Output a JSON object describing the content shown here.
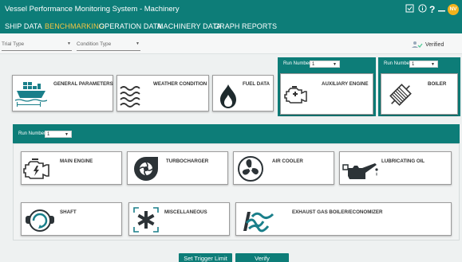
{
  "app": {
    "title": "Vessel Performance Monitoring System - Machinery",
    "avatar_initials": "NV"
  },
  "nav": {
    "items": [
      {
        "label": "SHIP DATA"
      },
      {
        "label": "BENCHMARKING"
      },
      {
        "label": "OPERATION DATA"
      },
      {
        "label": "MACHINERY DATA"
      },
      {
        "label": "GRAPH"
      },
      {
        "label": "REPORTS"
      }
    ],
    "active": "BENCHMARKING"
  },
  "filters": {
    "trial_type": "Trial Type",
    "condition_type": "Condition Type",
    "verified": "Verified"
  },
  "run_number": {
    "label": "Run Number",
    "auxiliary_value": "1",
    "boiler_value": "1",
    "main_value": "1"
  },
  "top_cards": {
    "general": "GENERAL PARAMETERS",
    "weather": "WEATHER CONDITION",
    "fuel": "FUEL DATA",
    "auxiliary": "AUXILIARY ENGINE",
    "boiler": "BOILER"
  },
  "main_cards": {
    "main_engine": "MAIN ENGINE",
    "turbocharger": "TURBOCHARGER",
    "air_cooler": "AIR COOLER",
    "lubricating_oil": "LUBRICATING OIL",
    "shaft": "SHAFT",
    "miscellaneous": "MISCELLANEOUS",
    "exhaust": "EXHAUST GAS BOILER/ECONOMIZER"
  },
  "buttons": {
    "set_trigger": "Set Trigger Limit",
    "verify": "Verify"
  },
  "colors": {
    "primary": "#0d7d78",
    "active_tab": "#f4c542",
    "avatar": "#f3b21c"
  }
}
